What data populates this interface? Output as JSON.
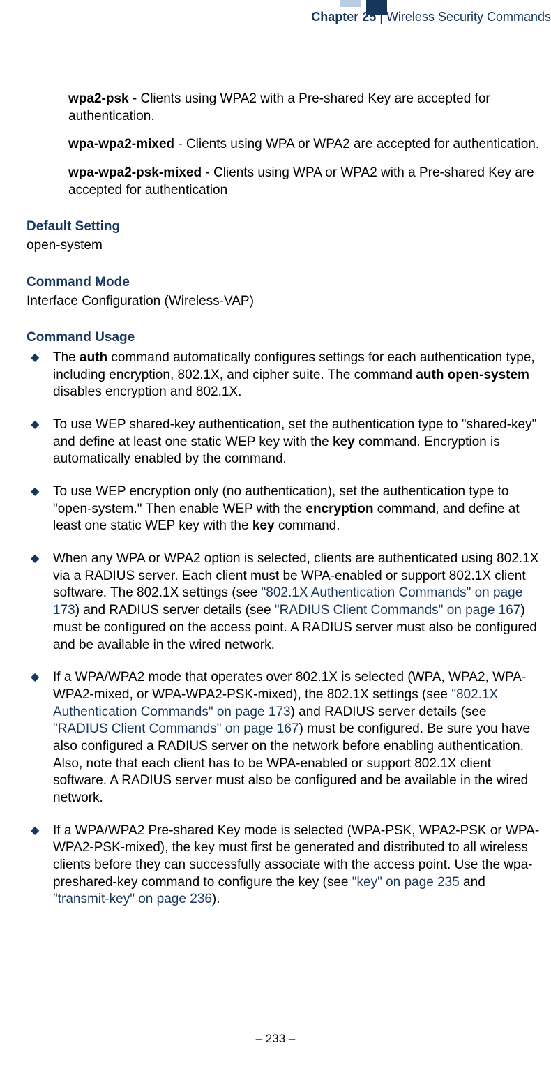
{
  "header": {
    "chapter_label": "Chapter 25",
    "separator": "  |  ",
    "chapter_title": "Wireless Security Commands"
  },
  "definitions": [
    {
      "term": "wpa2-psk",
      "desc": " - Clients using WPA2 with a Pre-shared Key are accepted for authentication."
    },
    {
      "term": "wpa-wpa2-mixed",
      "desc": " - Clients using WPA or WPA2 are accepted for authentication."
    },
    {
      "term": "wpa-wpa2-psk-mixed",
      "desc": " - Clients using WPA or WPA2 with a Pre-shared Key are accepted for authentication"
    }
  ],
  "default_setting": {
    "heading": "Default Setting",
    "value": "open-system"
  },
  "command_mode": {
    "heading": "Command Mode",
    "value": "Interface Configuration (Wireless-VAP)"
  },
  "command_usage": {
    "heading": "Command Usage",
    "bullets": [
      {
        "parts": [
          {
            "t": "The "
          },
          {
            "t": "auth",
            "bold": true
          },
          {
            "t": " command automatically configures settings for each authentication type, including encryption, 802.1X, and cipher suite. The command "
          },
          {
            "t": "auth open-system",
            "bold": true
          },
          {
            "t": " disables encryption and 802.1X."
          }
        ]
      },
      {
        "parts": [
          {
            "t": "To use WEP shared-key authentication, set the authentication type to \"shared-key\" and define at least one static WEP key with the "
          },
          {
            "t": "key",
            "bold": true
          },
          {
            "t": " command. Encryption is automatically enabled by the command."
          }
        ]
      },
      {
        "parts": [
          {
            "t": "To use WEP encryption only (no authentication), set the authentication type to \"open-system.\" Then enable WEP with the "
          },
          {
            "t": "encryption",
            "bold": true
          },
          {
            "t": " command, and define at least one static WEP key with the "
          },
          {
            "t": "key",
            "bold": true
          },
          {
            "t": " command."
          }
        ]
      },
      {
        "parts": [
          {
            "t": "When any WPA or WPA2 option is selected, clients are authenticated using 802.1X via a RADIUS server. Each client must be WPA-enabled or support 802.1X client software. The 802.1X settings (see "
          },
          {
            "t": "\"802.1X Authentication Commands\" on page 173",
            "link": true
          },
          {
            "t": ") and RADIUS server details (see "
          },
          {
            "t": "\"RADIUS Client Commands\" on page 167",
            "link": true
          },
          {
            "t": ") must be configured on the access point. A RADIUS server must also be configured and be available in the wired network."
          }
        ]
      },
      {
        "parts": [
          {
            "t": "If a WPA/WPA2 mode that operates over 802.1X is selected (WPA, WPA2, WPA-WPA2-mixed, or WPA-WPA2-PSK-mixed), the 802.1X settings (see "
          },
          {
            "t": "\"802.1X Authentication Commands\" on page 173",
            "link": true
          },
          {
            "t": ") and RADIUS server details (see "
          },
          {
            "t": "\"RADIUS Client Commands\" on page 167",
            "link": true
          },
          {
            "t": ") must be configured. Be sure you have also configured a RADIUS server on the network before enabling authentication. Also, note that each client has to be WPA-enabled or support 802.1X client software. A RADIUS server must also be configured and be available in the wired network."
          }
        ]
      },
      {
        "parts": [
          {
            "t": "If a WPA/WPA2 Pre-shared Key mode is selected (WPA-PSK, WPA2-PSK or WPA-WPA2-PSK-mixed), the key must first be generated and distributed to all wireless clients before they can successfully associate with the access point. Use the wpa-preshared-key command to configure the key (see "
          },
          {
            "t": "\"key\" on page 235",
            "link": true
          },
          {
            "t": " and "
          },
          {
            "t": "\"transmit-key\" on page 236",
            "link": true
          },
          {
            "t": ")."
          }
        ]
      }
    ]
  },
  "footer": {
    "page": "–  233  –"
  }
}
